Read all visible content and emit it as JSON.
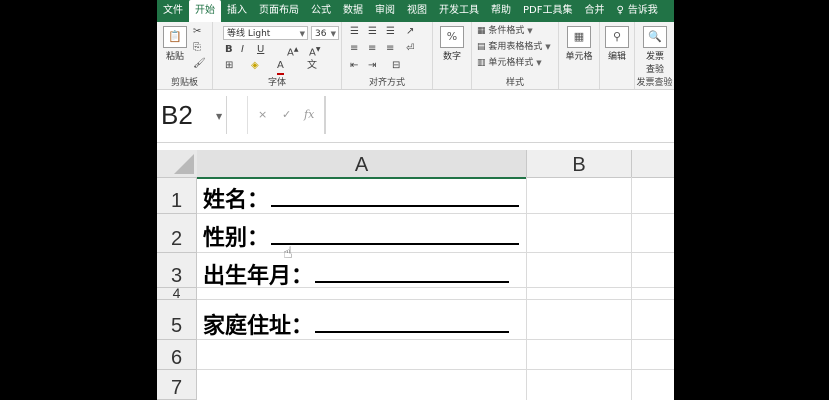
{
  "ribbon_tabs": [
    "文件",
    "开始",
    "插入",
    "页面布局",
    "公式",
    "数据",
    "审阅",
    "视图",
    "开发工具",
    "帮助",
    "PDF工具集",
    "合并",
    "告诉我"
  ],
  "active_tab": "开始",
  "clipboard": {
    "paste_label": "粘贴",
    "group_label": "剪贴板"
  },
  "font": {
    "name": "等线 Light",
    "size": "36",
    "bold": "B",
    "italic": "I",
    "underline": "U",
    "font_color": "A",
    "group_label": "字体"
  },
  "alignment": {
    "group_label": "对齐方式"
  },
  "number": {
    "label": "数字",
    "symbol": "%"
  },
  "styles": {
    "conditional": "条件格式",
    "table": "套用表格格式",
    "cell": "单元格样式",
    "group_label": "样式"
  },
  "cells": {
    "label": "单元格"
  },
  "editing": {
    "label": "编辑"
  },
  "invoice": {
    "label_line1": "发票",
    "label_line2": "查验",
    "group_label": "发票查验"
  },
  "name_box": "B2",
  "formula_bar": {
    "cancel": "×",
    "enter": "✓",
    "fx": "fx"
  },
  "columns": [
    "A",
    "B"
  ],
  "rows": [
    "1",
    "2",
    "3",
    "4",
    "5",
    "6",
    "7"
  ],
  "cells_text": {
    "r1": "姓名：",
    "r2": "性别：",
    "r3": "出生年月：",
    "r5": "家庭住址："
  },
  "accent_color": "#217346"
}
